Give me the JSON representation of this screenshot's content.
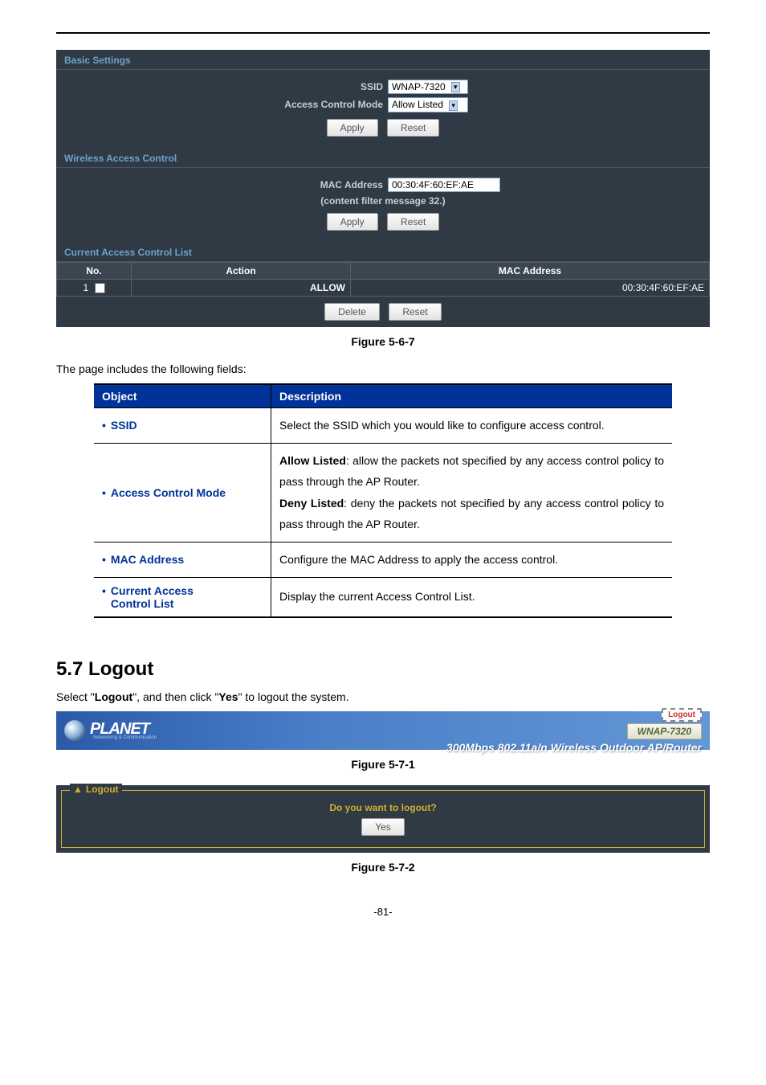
{
  "basic_settings": {
    "title": "Basic Settings",
    "ssid_label": "SSID",
    "ssid_value": "WNAP-7320",
    "mode_label": "Access Control Mode",
    "mode_value": "Allow Listed",
    "apply": "Apply",
    "reset": "Reset"
  },
  "wac": {
    "title": "Wireless Access Control",
    "mac_label": "MAC Address",
    "mac_value": "00:30:4F:60:EF:AE",
    "note": "(content filter message 32.)",
    "apply": "Apply",
    "reset": "Reset"
  },
  "acl": {
    "title": "Current Access Control List",
    "col_no": "No.",
    "col_action": "Action",
    "col_mac": "MAC Address",
    "rows": [
      {
        "no": "1",
        "action": "ALLOW",
        "mac": "00:30:4F:60:EF:AE"
      }
    ],
    "delete": "Delete",
    "reset": "Reset"
  },
  "fig1": "Figure 5-6-7",
  "intro": "The page includes the following fields:",
  "table": {
    "h1": "Object",
    "h2": "Description",
    "r1_name": "SSID",
    "r1_desc": "Select the SSID which you would like to configure access control.",
    "r2_name": "Access Control Mode",
    "r2_desc_p1a": "Allow Listed",
    "r2_desc_p1b": ": allow the packets not specified by any access control policy to pass through the AP Router.",
    "r2_desc_p2a": "Deny Listed",
    "r2_desc_p2b": ": deny the packets not specified by any access control policy to pass through the AP Router.",
    "r3_name": "MAC Address",
    "r3_desc": "Configure the MAC Address to apply the access control.",
    "r4_name1": "Current Access",
    "r4_name2": "Control List",
    "r4_desc": "Display the current Access Control List."
  },
  "logout_section": {
    "heading": "5.7  Logout",
    "text_a": "Select \"",
    "text_b": "Logout",
    "text_c": "\", and then click \"",
    "text_d": "Yes",
    "text_e": "\" to logout the system."
  },
  "banner": {
    "brand": "PLANET",
    "sub": "Networking & Communication",
    "logout": "Logout",
    "model": "WNAP-7320",
    "tagline": "300Mbps 802.11a/n Wireless Outdoor AP/Router"
  },
  "fig2": "Figure 5-7-1",
  "logout_box": {
    "legend": "Logout",
    "prompt": "Do you want to logout?",
    "yes": "Yes"
  },
  "fig3": "Figure 5-7-2",
  "page_num": "-81-"
}
